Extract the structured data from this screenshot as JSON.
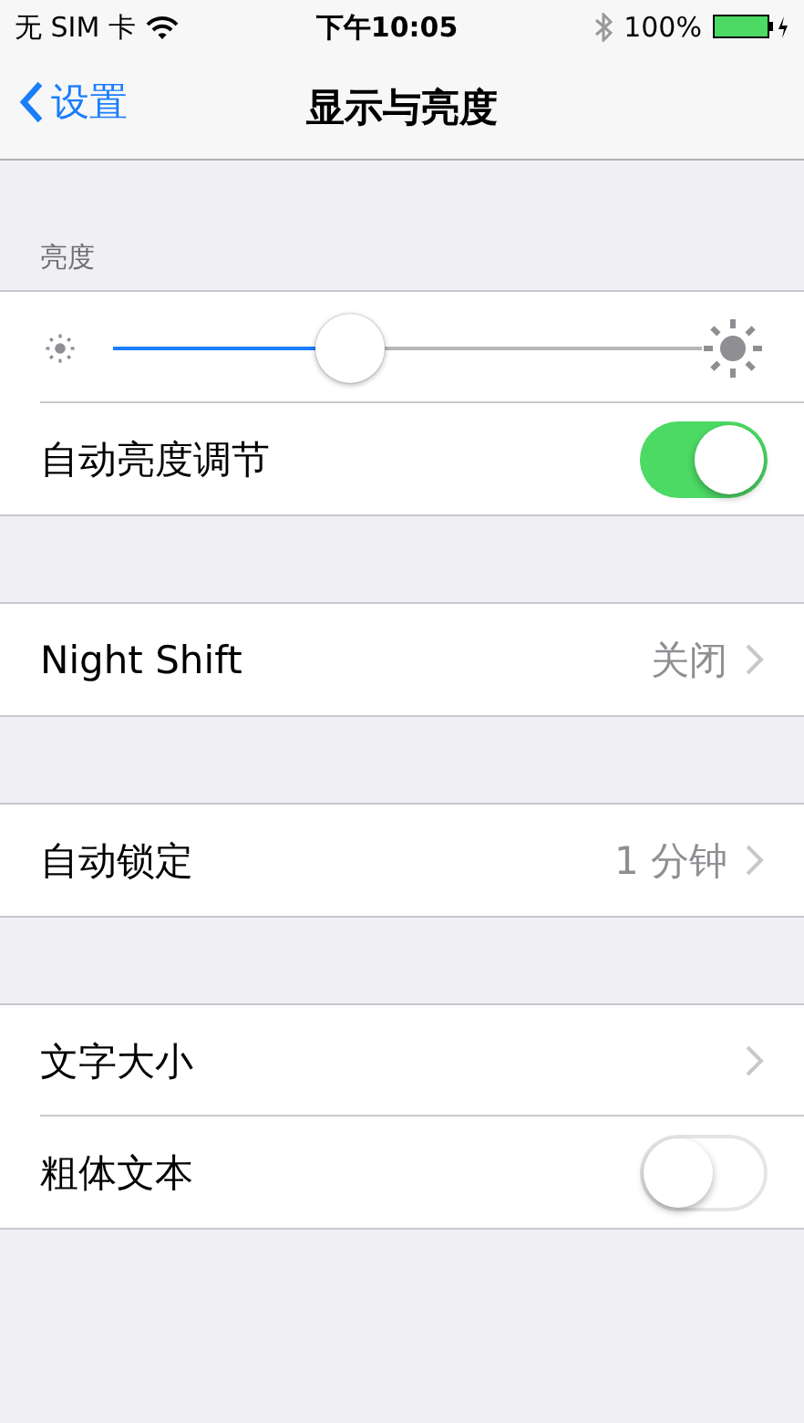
{
  "status_bar": {
    "carrier": "无 SIM 卡",
    "time": "下午10:05",
    "battery": "100%"
  },
  "nav": {
    "back": "设置",
    "title": "显示与亮度"
  },
  "sections": [
    {
      "header": "亮度",
      "rows": [
        {
          "kind": "slider",
          "level": 0.39
        },
        {
          "kind": "toggle",
          "label": "自动亮度调节",
          "on": true
        }
      ]
    },
    {
      "rows": [
        {
          "kind": "disclosure",
          "label": "Night Shift",
          "value": "关闭"
        }
      ]
    },
    {
      "rows": [
        {
          "kind": "disclosure",
          "label": "自动锁定",
          "value": "1 分钟"
        }
      ]
    },
    {
      "rows": [
        {
          "kind": "disclosure",
          "label": "文字大小"
        },
        {
          "kind": "toggle",
          "label": "粗体文本",
          "on": false
        }
      ]
    }
  ]
}
